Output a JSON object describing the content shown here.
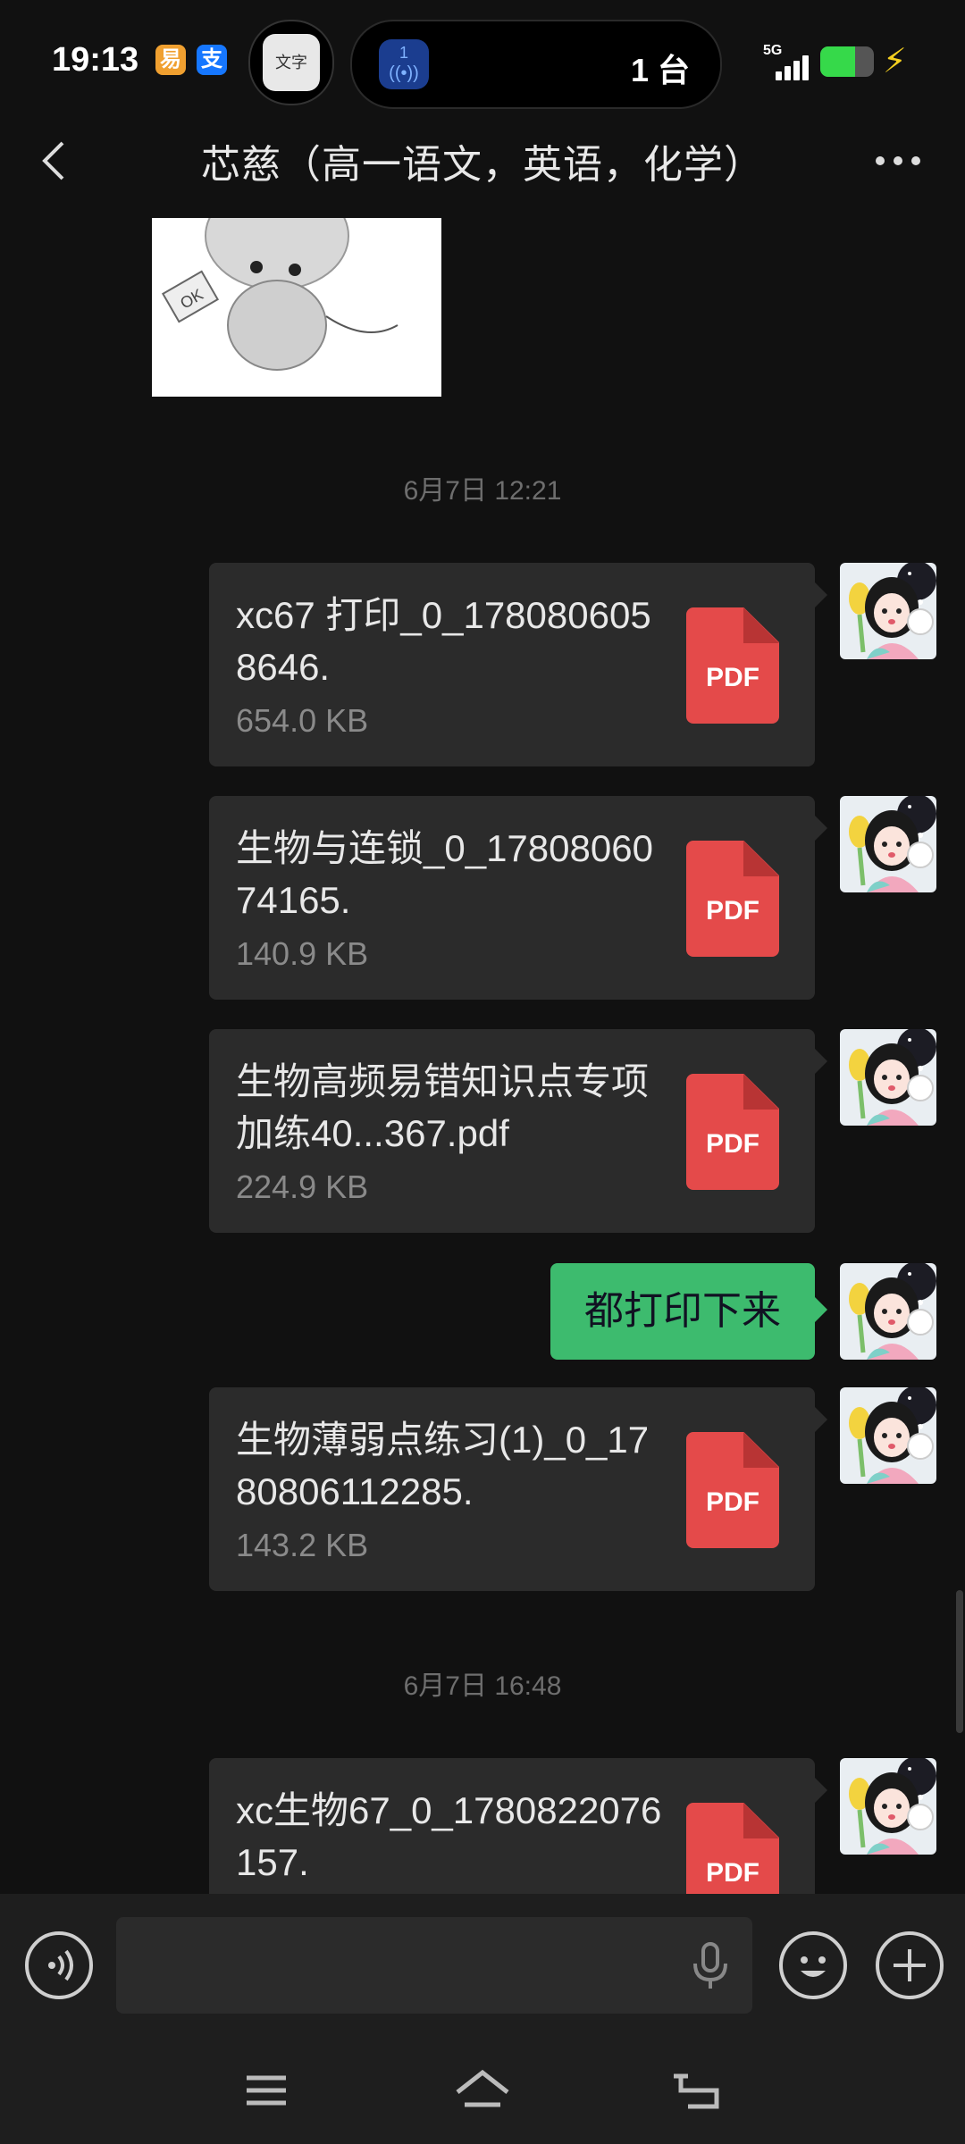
{
  "status_bar": {
    "time": "19:13",
    "mini_icons": [
      "易",
      "支"
    ],
    "float_app_label": "文字",
    "cast_number": "1",
    "device_count": "1 台",
    "network": "5G",
    "battery_percent": 65,
    "colors": {
      "battery": "#36d94a",
      "charging": "#f5d020"
    }
  },
  "header": {
    "title": "芯慈（高一语文，英语，化学）",
    "back_icon": "chevron-left-icon",
    "more_icon": "ellipsis-icon"
  },
  "chat": {
    "timestamps": [
      "6月7日 12:21",
      "6月7日 16:48"
    ],
    "messages": [
      {
        "type": "file",
        "name": "xc67 打印_0_1780806058646.",
        "size": "654.0 KB",
        "icon_label": "PDF"
      },
      {
        "type": "file",
        "name": "生物与连锁_0_1780806074165.",
        "size": "140.9 KB",
        "icon_label": "PDF"
      },
      {
        "type": "file",
        "name": "生物高频易错知识点专项加练40...367.pdf",
        "size": "224.9 KB",
        "icon_label": "PDF"
      },
      {
        "type": "text",
        "text": "都打印下来"
      },
      {
        "type": "file",
        "name": "生物薄弱点练习(1)_0_1780806112285.",
        "size": "143.2 KB",
        "icon_label": "PDF"
      },
      {
        "type": "file",
        "name": "xc生物67_0_1780822076157.",
        "size": "",
        "icon_label": "PDF"
      }
    ],
    "colors": {
      "file_card": "#2b2b2b",
      "text_bubble": "#3dbb6e",
      "pdf": "#e44a4a"
    }
  },
  "input_bar": {
    "voice_icon": "voice-icon",
    "mic_icon": "microphone-icon",
    "emoji_icon": "emoji-icon",
    "plus_icon": "plus-icon",
    "value": ""
  },
  "nav_bar": {
    "icons": [
      "menu-icon",
      "home-icon",
      "back-icon"
    ]
  }
}
